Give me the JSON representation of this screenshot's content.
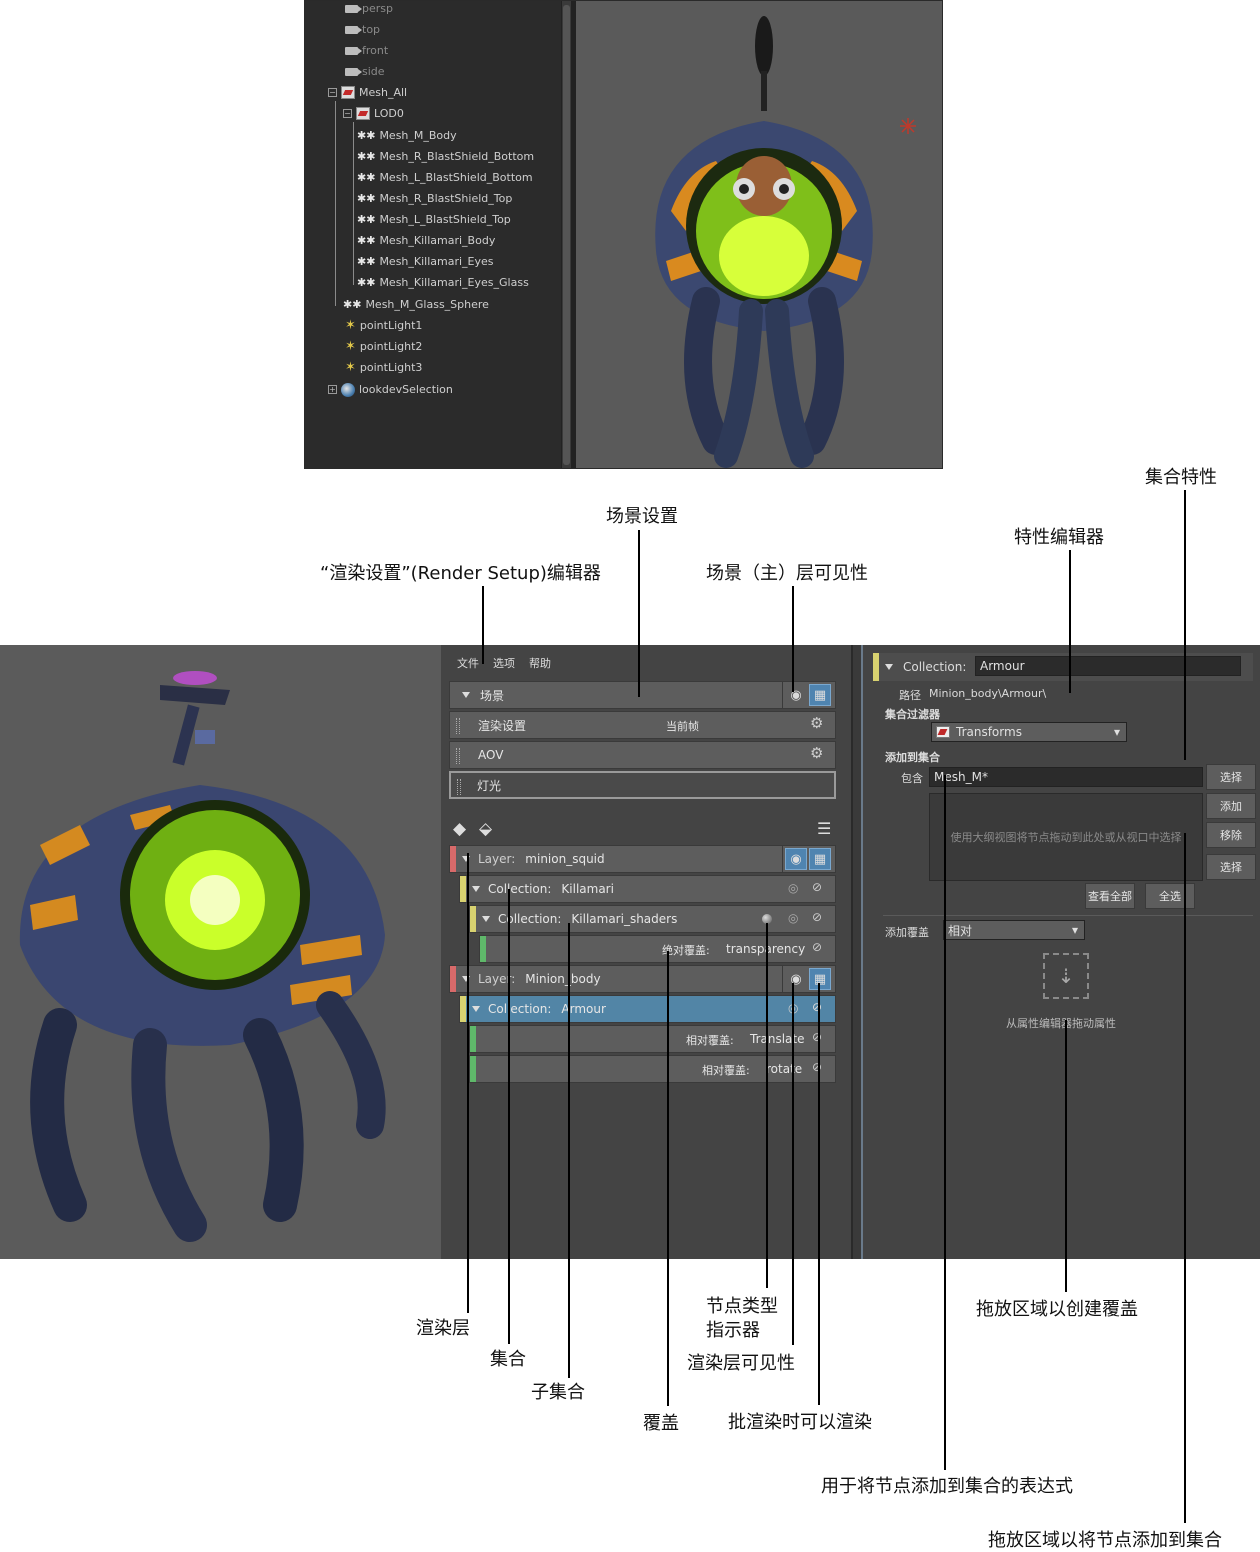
{
  "outliner": {
    "items": [
      {
        "label": "persp",
        "kind": "camera"
      },
      {
        "label": "top",
        "kind": "camera"
      },
      {
        "label": "front",
        "kind": "camera"
      },
      {
        "label": "side",
        "kind": "camera"
      },
      {
        "label": "Mesh_All",
        "kind": "set"
      },
      {
        "label": "LOD0",
        "kind": "set"
      },
      {
        "label": "Mesh_M_Body",
        "kind": "mesh"
      },
      {
        "label": "Mesh_R_BlastShield_Bottom",
        "kind": "mesh"
      },
      {
        "label": "Mesh_L_BlastShield_Bottom",
        "kind": "mesh"
      },
      {
        "label": "Mesh_R_BlastShield_Top",
        "kind": "mesh"
      },
      {
        "label": "Mesh_L_BlastShield_Top",
        "kind": "mesh"
      },
      {
        "label": "Mesh_Killamari_Body",
        "kind": "mesh"
      },
      {
        "label": "Mesh_Killamari_Eyes",
        "kind": "mesh"
      },
      {
        "label": "Mesh_Killamari_Eyes_Glass",
        "kind": "mesh"
      },
      {
        "label": "Mesh_M_Glass_Sphere",
        "kind": "mesh"
      },
      {
        "label": "pointLight1",
        "kind": "light"
      },
      {
        "label": "pointLight2",
        "kind": "light"
      },
      {
        "label": "pointLight3",
        "kind": "light"
      },
      {
        "label": "lookdevSelection",
        "kind": "selection"
      }
    ]
  },
  "render_setup": {
    "menu": [
      "文件",
      "选项",
      "帮助"
    ],
    "scene_label": "场景",
    "render_settings_label": "渲染设置",
    "current_frame_label": "当前帧",
    "aov_label": "AOV",
    "lights_label": "灯光",
    "layer1": {
      "prefix": "Layer:",
      "name": "minion_squid"
    },
    "collection1": {
      "prefix": "Collection:",
      "name": "Killamari"
    },
    "subcollection1": {
      "prefix": "Collection:",
      "name": "Killamari_shaders"
    },
    "override1": {
      "prefix": "绝对覆盖:",
      "name": "transparency"
    },
    "layer2": {
      "prefix": "Layer:",
      "name": "Minion_body"
    },
    "collection2": {
      "prefix": "Collection:",
      "name": "Armour"
    },
    "override2": {
      "prefix": "相对覆盖:",
      "name": "Translate"
    },
    "override3": {
      "prefix": "相对覆盖:",
      "name": "rotate"
    }
  },
  "attribute_editor": {
    "collection_prefix": "Collection:",
    "collection_name": "Armour",
    "path_label": "路径",
    "path_value": "Minion_body\\Armour\\",
    "filter_label": "集合过滤器",
    "filter_value": "Transforms",
    "add_to_collection_label": "添加到集合",
    "include_label": "包含",
    "include_value": "Mesh_M*",
    "select_button": "选择",
    "add_button": "添加",
    "remove_button": "移除",
    "select_button_2": "选择",
    "drop_hint": "使用大纲视图将节点拖动到此处或从视口中选择",
    "view_all_button": "查看全部",
    "select_all_button": "全选",
    "add_override_label": "添加覆盖",
    "override_mode": "相对",
    "drag_attr_hint": "从属性编辑器拖动属性"
  },
  "callouts": {
    "render_setup_editor": "“渲染设置”(Render Setup)编辑器",
    "scene_settings": "场景设置",
    "scene_master_visibility": "场景（主）层可见性",
    "property_editor": "特性编辑器",
    "collection_properties": "集合特性",
    "render_layer": "渲染层",
    "collection": "集合",
    "subcollection": "子集合",
    "override": "覆盖",
    "node_type_indicator_1": "节点类型",
    "node_type_indicator_2": "指示器",
    "render_layer_visibility": "渲染层可见性",
    "renderable_in_batch": "批渲染时可以渲染",
    "drop_zone_override": "拖放区域以创建覆盖",
    "expression_add_nodes": "用于将节点添加到集合的表达式",
    "drop_zone_add_nodes": "拖放区域以将节点添加到集合"
  },
  "colors": {
    "layer_swatch": "#d86a6a",
    "collection_swatch": "#d8d270",
    "override_swatch": "#5fb86a",
    "selected_row": "#5285a6",
    "panel_bg": "#444444"
  }
}
